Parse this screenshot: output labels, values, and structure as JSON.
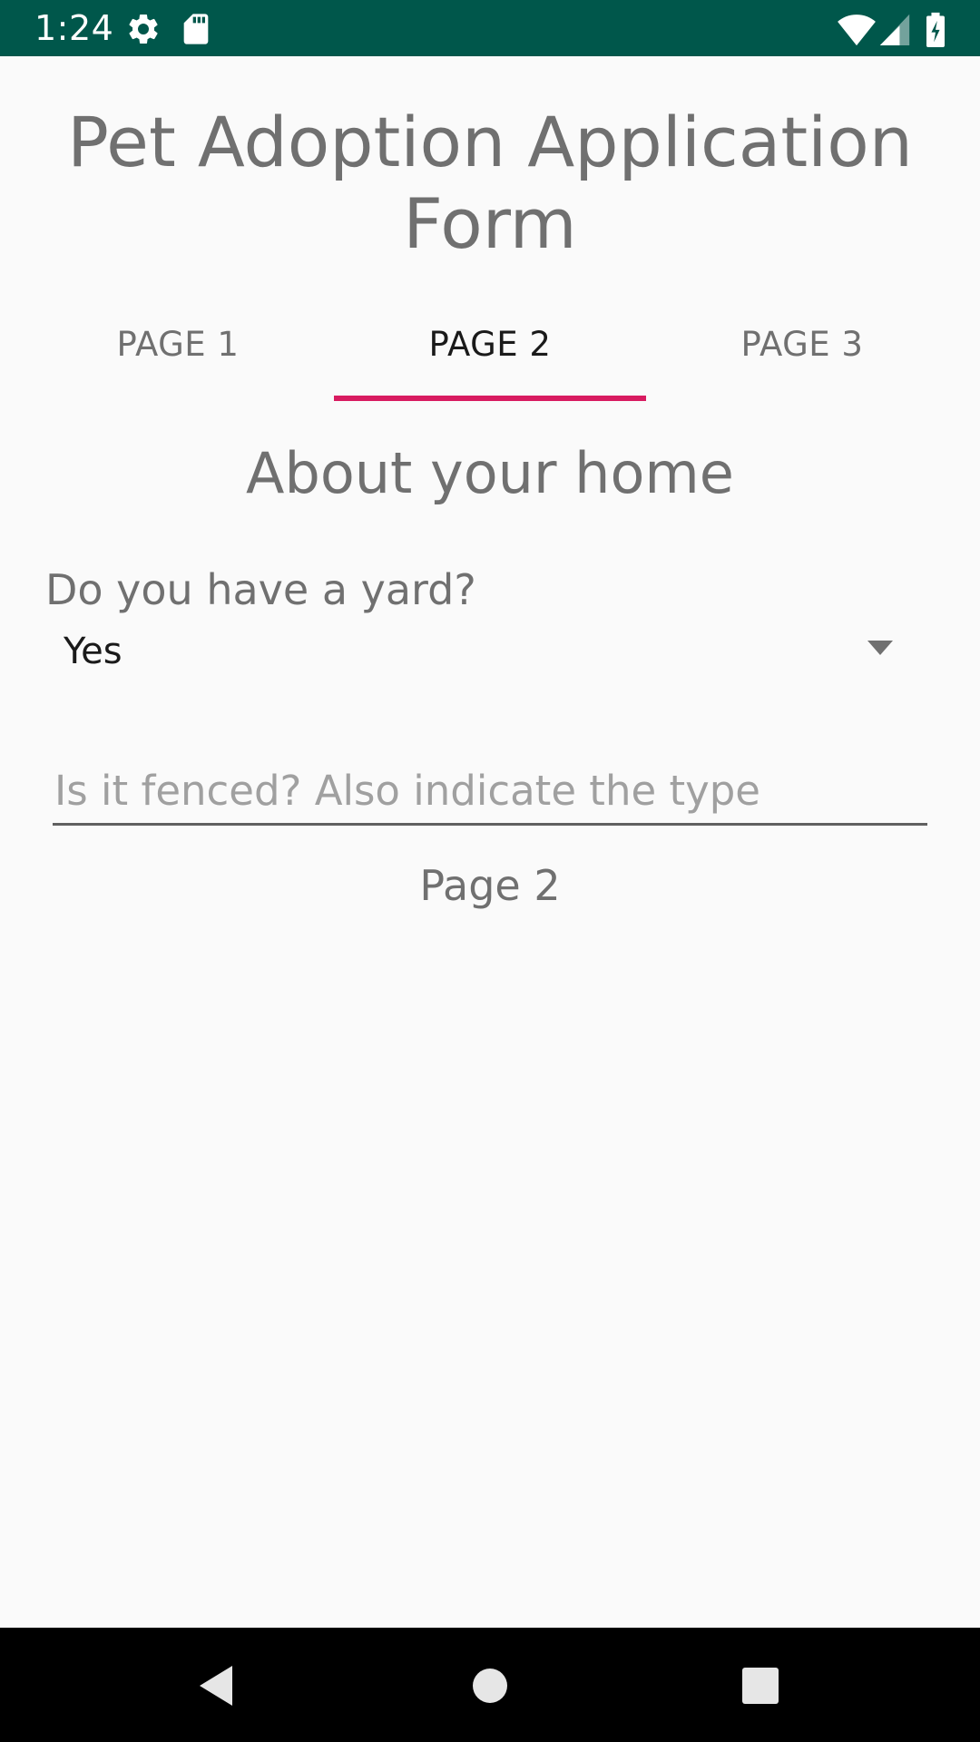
{
  "status_bar": {
    "time": "1:24",
    "icons": [
      "gear-icon",
      "sd-card-icon",
      "wifi-icon",
      "signal-icon",
      "battery-charging-icon"
    ],
    "background_color": "#00574b"
  },
  "header": {
    "title": "Pet Adoption Application Form"
  },
  "tabs": [
    {
      "label": "PAGE 1",
      "active": false
    },
    {
      "label": "PAGE 2",
      "active": true
    },
    {
      "label": "PAGE 3",
      "active": false
    }
  ],
  "tab_indicator_color": "#d81b60",
  "section": {
    "heading": "About your home"
  },
  "yard_question": {
    "label": "Do you have a yard?",
    "selected_value": "Yes"
  },
  "fence_field": {
    "value": "",
    "placeholder": "Is it fenced? Also indicate the type"
  },
  "page_label": "Page 2",
  "nav_bar": {
    "buttons": [
      "back-icon",
      "home-icon",
      "recents-icon"
    ]
  }
}
